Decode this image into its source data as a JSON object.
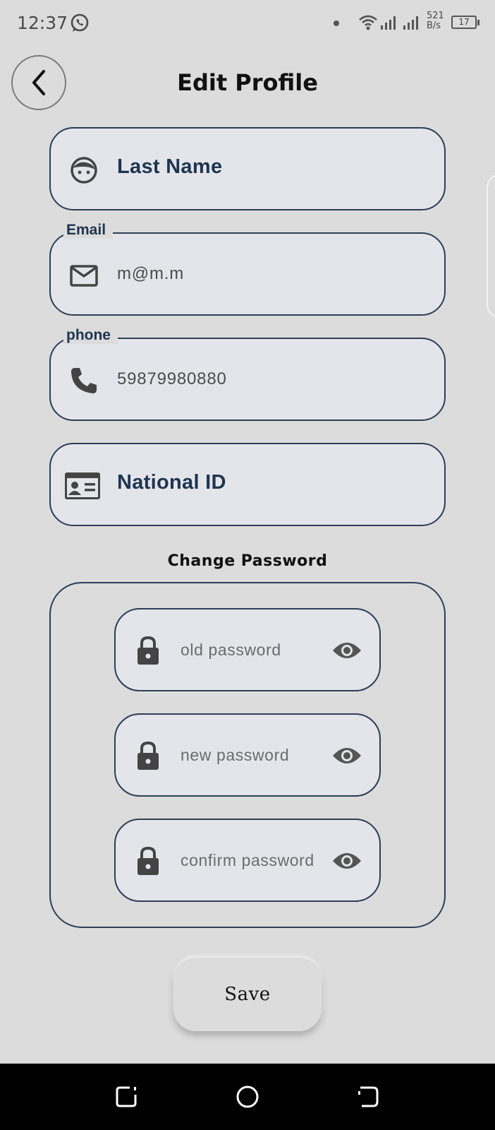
{
  "status_bar": {
    "time": "12:37",
    "net_speed_value": "521",
    "net_speed_unit": "B/s",
    "battery": "17"
  },
  "header": {
    "title": "Edit Profile"
  },
  "fields": {
    "last_name": {
      "placeholder": "Last Name",
      "icon": "face-icon"
    },
    "email": {
      "label": "Email",
      "value": "m@m.m",
      "icon": "mail-icon"
    },
    "phone": {
      "label": "phone",
      "value": "59879980880",
      "icon": "phone-icon"
    },
    "national_id": {
      "placeholder": "National ID",
      "icon": "id-card-icon"
    }
  },
  "change_password": {
    "title": "Change Password",
    "old": {
      "placeholder": "old password"
    },
    "new": {
      "placeholder": "new password"
    },
    "confirm": {
      "placeholder": "confirm password"
    }
  },
  "save_label": "Save",
  "colors": {
    "background": "#dcdcdc",
    "field_fill": "#e4e5ea",
    "field_border": "#2b3f57",
    "label_text": "#1e3550"
  }
}
